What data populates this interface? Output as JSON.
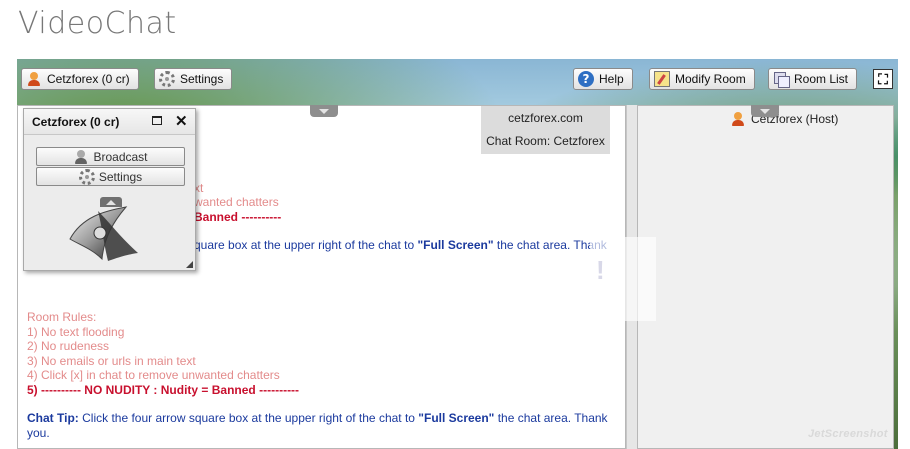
{
  "page": {
    "title": "VideoChat"
  },
  "toolbar": {
    "user_button": "Cetzforex (0 cr)",
    "settings_button": "Settings",
    "help_button": "Help",
    "modify_room_button": "Modify Room",
    "room_list_button": "Room List",
    "fullscreen_glyph": "⛶"
  },
  "room_info": {
    "site": "cetzforex.com",
    "room": "Chat Room: Cetzforex"
  },
  "popup": {
    "title": "Cetzforex (0 cr)",
    "broadcast_button": "Broadcast",
    "settings_button": "Settings",
    "behind_lines": [
      "xt",
      "wanted chatters",
      "Banned ----------",
      "quare box at the upper right of the chat to ",
      "\"Full Screen\"",
      " the chat area. Thank"
    ]
  },
  "messages": {
    "rules_header": "Room Rules:",
    "rules": [
      "1) No text flooding",
      "2) No rudeness",
      "3) No emails or urls in main text",
      "4) Click [x] in chat to remove unwanted chatters"
    ],
    "nudity_rule": "5) ---------- NO NUDITY : Nudity = Banned ----------",
    "tip_label": "Chat Tip:",
    "tip_before": " Click the four arrow square box at the upper right of the chat to ",
    "tip_bold": "\"Full Screen\"",
    "tip_after": " the chat area. Thank you."
  },
  "users": [
    {
      "name": "Cetzforex (Host)"
    }
  ],
  "watermark": "JetScreenshot",
  "overlay_glyph": "!",
  "colors": {
    "rule_text": "#e38b8b",
    "nudity_rule": "#c8102e",
    "tip_text": "#1b3a9e",
    "title_text": "#777777"
  }
}
